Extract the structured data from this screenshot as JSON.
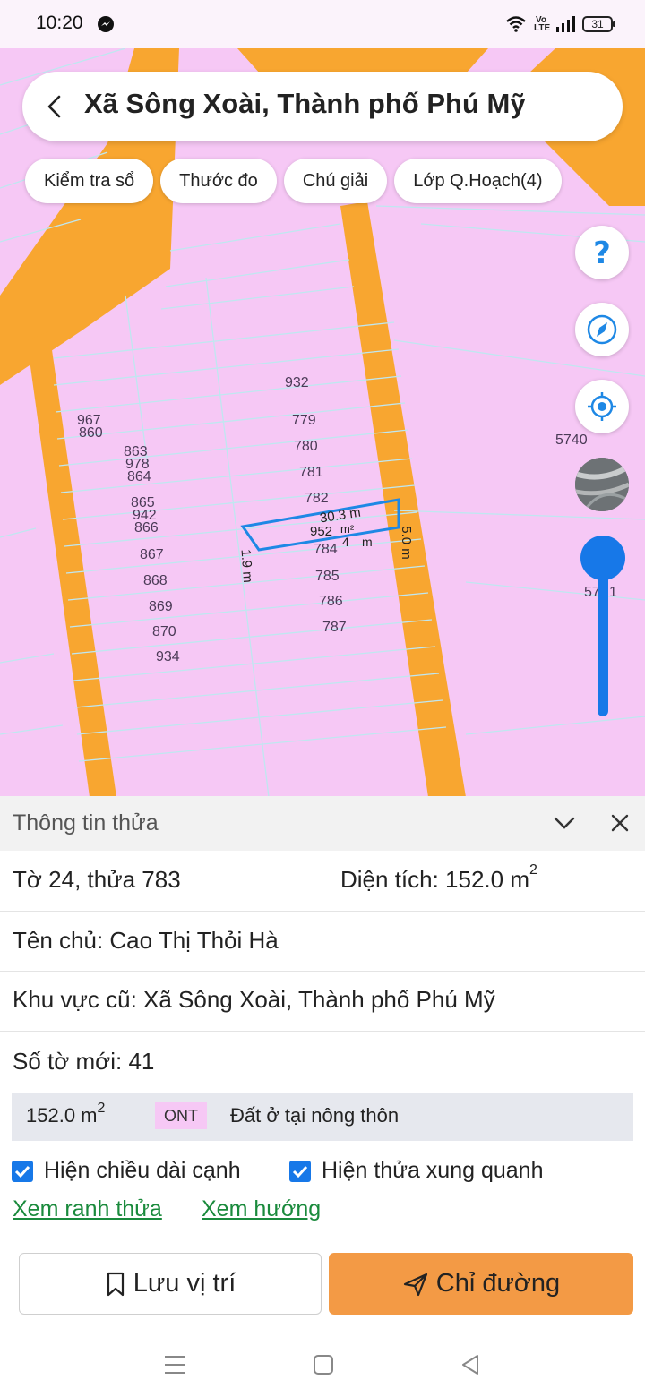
{
  "status_bar": {
    "time": "10:20",
    "volte_label": "Vo LTE",
    "battery": "31"
  },
  "map": {
    "search_title": "Xã Sông Xoài, Thành phố Phú Mỹ",
    "chips": [
      "Kiểm tra sổ",
      "Thước đo",
      "Chú giải",
      "Lớp Q.Hoạch(4)"
    ],
    "parcel_numbers": {
      "p932": "932",
      "p779": "779",
      "p780": "780",
      "p781": "781",
      "p782": "782",
      "p784": "784",
      "p785": "785",
      "p786": "786",
      "p787": "787",
      "p967": "967",
      "p860": "860",
      "p863": "863",
      "p978": "978",
      "p864": "864",
      "p865": "865",
      "p942": "942",
      "p866": "866",
      "p867": "867",
      "p868": "868",
      "p869": "869",
      "p870": "870",
      "p934": "934",
      "p5740": "5740",
      "p571": "57",
      "p572": "1",
      "p952": "952"
    },
    "measurements": {
      "top_edge": "30.3 m",
      "area": "m²",
      "bottom_edge": "m",
      "bottom_prefix": "4",
      "right_edge": "5.0 m",
      "left_edge": "1.9 m"
    },
    "colors": {
      "land": "#f6c8f5",
      "road": "#f8a630",
      "selection": "#1e88e5",
      "accent": "#1778e8"
    }
  },
  "panel": {
    "title": "Thông tin thửa",
    "sheet_parcel": "Tờ 24, thửa 783",
    "area_label": "Diện tích: 152.0 m",
    "area_sup": "2",
    "owner": "Tên chủ: Cao Thị Thỏi Hà",
    "old_area": "Khu vực cũ: Xã Sông Xoài, Thành phố Phú Mỹ",
    "new_sheet": "Số tờ mới: 41",
    "land_use": {
      "area": "152.0 m",
      "area_sup": "2",
      "code": "ONT",
      "description": "Đất ở tại nông thôn"
    },
    "checkboxes": [
      {
        "label": "Hiện chiều dài cạnh",
        "checked": true
      },
      {
        "label": "Hiện thửa xung quanh",
        "checked": true
      }
    ],
    "links": [
      "Xem ranh thửa",
      "Xem hướng"
    ],
    "save_button": "Lưu vị trí",
    "directions_button": "Chỉ đường"
  }
}
